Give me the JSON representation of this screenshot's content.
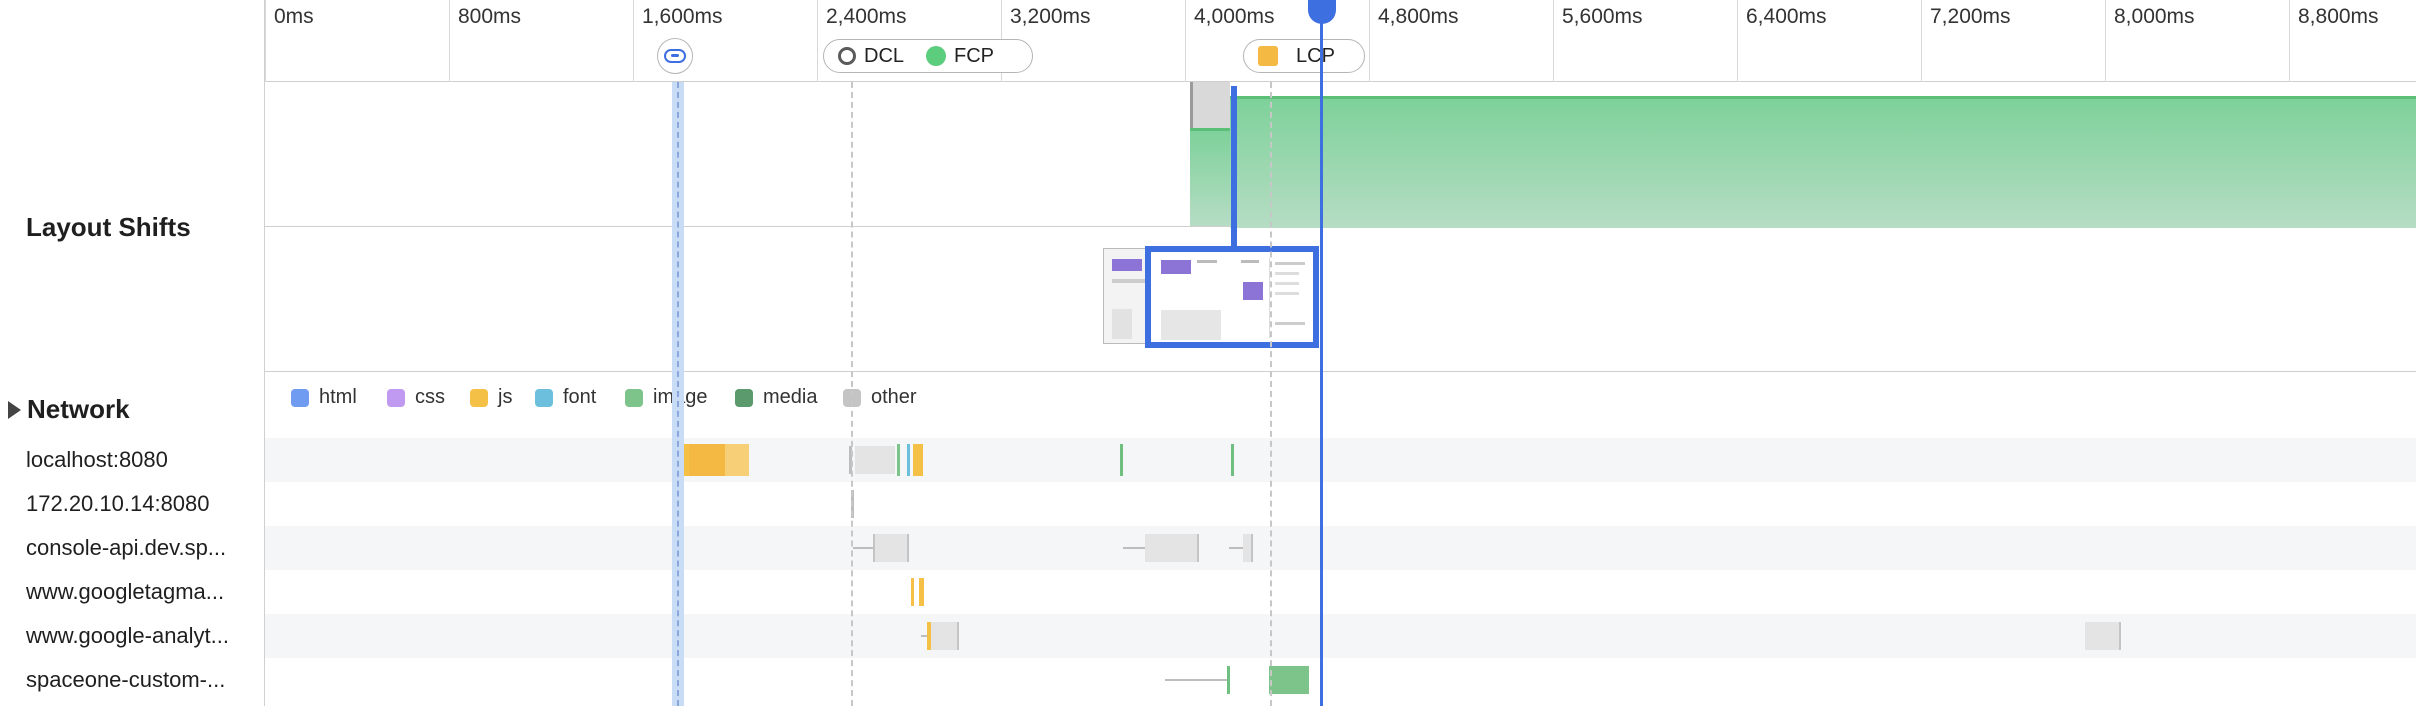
{
  "ruler": {
    "ticks": [
      "0ms",
      "800ms",
      "1,600ms",
      "2,400ms",
      "3,200ms",
      "4,000ms",
      "4,800ms",
      "5,600ms",
      "6,400ms",
      "7,200ms",
      "8,000ms",
      "8,800ms"
    ]
  },
  "markers": {
    "navigation_icon": "link-icon",
    "dcl_label": "DCL",
    "fcp_label": "FCP",
    "lcp_label": "LCP"
  },
  "sections": {
    "layout_shifts": "Layout Shifts",
    "network": "Network"
  },
  "legend": [
    {
      "label": "html",
      "color": "#6f9cf0"
    },
    {
      "label": "css",
      "color": "#c09af0"
    },
    {
      "label": "js",
      "color": "#f4c046"
    },
    {
      "label": "font",
      "color": "#6cc0de"
    },
    {
      "label": "image",
      "color": "#7cc489"
    },
    {
      "label": "media",
      "color": "#5a9a6c"
    },
    {
      "label": "other",
      "color": "#c4c4c4"
    }
  ],
  "network_rows": [
    {
      "host": "localhost:8080"
    },
    {
      "host": "172.20.10.14:8080"
    },
    {
      "host": "console-api.dev.sp..."
    },
    {
      "host": "www.googletagma..."
    },
    {
      "host": "www.google-analyt..."
    },
    {
      "host": "spaceone-custom-..."
    }
  ],
  "colors": {
    "accent_blue": "#3e6fe0",
    "nav_band": "#c9dcf6",
    "lcp_green": "#5ccc7d"
  }
}
